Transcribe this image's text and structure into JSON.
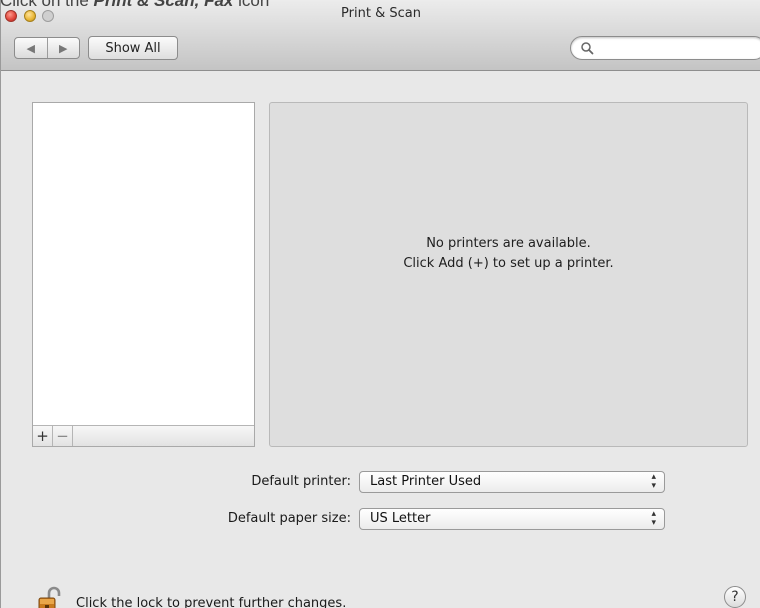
{
  "caption": {
    "prefix": "Click on the ",
    "emphasis": "Print & Scan, Fax",
    "suffix": " icon"
  },
  "window": {
    "title": "Print & Scan"
  },
  "toolbar": {
    "back_glyph": "◀",
    "forward_glyph": "▶",
    "show_all_label": "Show All",
    "search_placeholder": ""
  },
  "printer_list": {
    "add_label": "+",
    "remove_label": "−"
  },
  "detail": {
    "line1": "No printers are available.",
    "line2": "Click Add (+) to set up a printer."
  },
  "defaults": {
    "printer_label": "Default printer:",
    "printer_value": "Last Printer Used",
    "paper_label": "Default paper size:",
    "paper_value": "US Letter"
  },
  "footer": {
    "lock_text": "Click the lock to prevent further changes.",
    "help_label": "?"
  },
  "colors": {
    "window_bg": "#e8e8e8",
    "close": "#e0443a",
    "minimize": "#e8b534"
  },
  "icons": [
    "search-icon",
    "lock-icon",
    "add-icon",
    "remove-icon",
    "back-icon",
    "forward-icon"
  ]
}
